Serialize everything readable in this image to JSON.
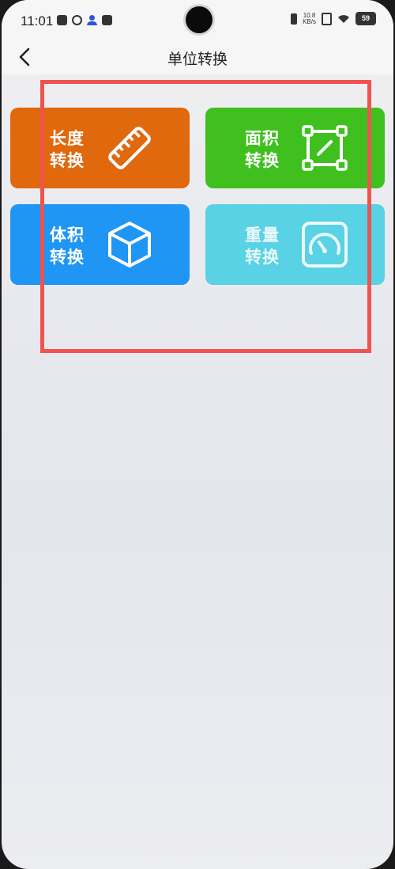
{
  "status_bar": {
    "time": "11:01",
    "net_speed_value": "10.8",
    "net_speed_unit": "KB/s",
    "battery": "59",
    "left_icons": [
      "tiktok-icon",
      "ring-icon",
      "person-icon",
      "bag-icon"
    ],
    "right_icons": [
      "vibrate-icon",
      "sim-icon",
      "wifi-icon",
      "battery-icon"
    ]
  },
  "header": {
    "title": "单位转换",
    "back_icon": "chevron-left-icon"
  },
  "tiles": [
    {
      "line1": "长度",
      "line2": "转换",
      "icon": "ruler-icon",
      "color": "#e0680d"
    },
    {
      "line1": "面积",
      "line2": "转换",
      "icon": "area-frame-icon",
      "color": "#3fc01f"
    },
    {
      "line1": "体积",
      "line2": "转换",
      "icon": "cube-icon",
      "color": "#1f95f4"
    },
    {
      "line1": "重量",
      "line2": "转换",
      "icon": "scale-gauge-icon",
      "color": "#58d2e4"
    }
  ],
  "annotation": {
    "color": "#ef5350"
  }
}
